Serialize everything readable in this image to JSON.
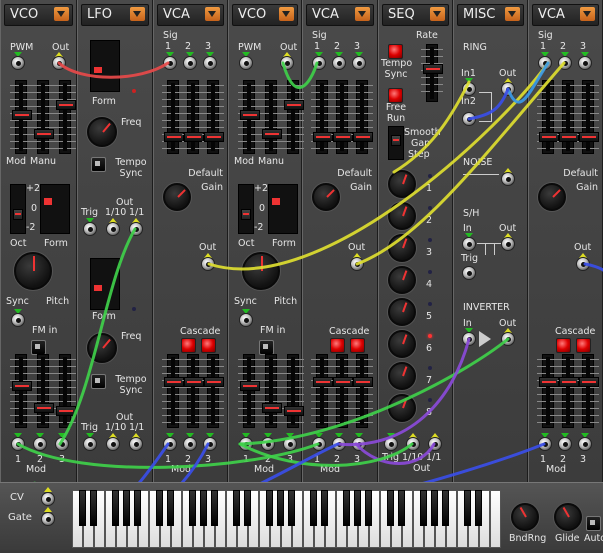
{
  "modules": [
    {
      "id": "vco1",
      "title": "VCO",
      "labels": {
        "pwm": "PWM",
        "out": "Out",
        "mod": "Mod",
        "manu": "Manu",
        "plus2": "+2",
        "zero": "0",
        "minus2": "-2",
        "oct": "Oct",
        "form": "Form",
        "sync": "Sync",
        "pitch": "Pitch",
        "fm_in": "FM in",
        "n1": "1",
        "n2": "2",
        "n3": "3",
        "mod_footer": "Mod"
      }
    },
    {
      "id": "lfo",
      "title": "LFO",
      "labels": {
        "form": "Form",
        "freq": "Freq",
        "tempo_sync": "Tempo Sync",
        "out": "Out",
        "trig": "Trig",
        "div10": "1/10",
        "div1": "1/1",
        "form2": "Form",
        "freq2": "Freq",
        "tempo_sync2": "Tempo Sync",
        "out2": "Out",
        "trig2": "Trig",
        "div10b": "1/10",
        "div1b": "1/1"
      }
    },
    {
      "id": "vca1",
      "title": "VCA",
      "labels": {
        "sig": "Sig",
        "n1": "1",
        "n2": "2",
        "n3": "3",
        "default_gain": "Default Gain",
        "out": "Out",
        "cascade": "Cascade",
        "mod_footer": "Mod"
      }
    },
    {
      "id": "vco2",
      "title": "VCO",
      "labels": {
        "pwm": "PWM",
        "out": "Out",
        "mod": "Mod",
        "manu": "Manu",
        "plus2": "+2",
        "zero": "0",
        "minus2": "-2",
        "oct": "Oct",
        "form": "Form",
        "sync": "Sync",
        "pitch": "Pitch",
        "fm_in": "FM in",
        "n1": "1",
        "n2": "2",
        "n3": "3",
        "mod_footer": "Mod"
      }
    },
    {
      "id": "vca2",
      "title": "VCA",
      "labels": {
        "sig": "Sig",
        "n1": "1",
        "n2": "2",
        "n3": "3",
        "default_gain": "Default Gain",
        "out": "Out",
        "cascade": "Cascade",
        "mod_footer": "Mod"
      }
    },
    {
      "id": "seq",
      "title": "SEQ",
      "labels": {
        "rate": "Rate",
        "tempo_sync": "Tempo Sync",
        "free_run": "Free Run",
        "smooth": "Smooth",
        "gap": "Gap",
        "step": "Step",
        "trig": "Trig",
        "div10": "1/10",
        "div1": "1/1",
        "out": "Out"
      },
      "steps": [
        "1",
        "2",
        "3",
        "4",
        "5",
        "6",
        "7",
        "8"
      ]
    },
    {
      "id": "misc",
      "title": "MISC",
      "labels": {
        "ring": "RING",
        "in1": "In1",
        "in2": "In2",
        "out": "Out",
        "noise": "NOISE",
        "sh": "S/H",
        "sh_in": "In",
        "sh_out": "Out",
        "trig": "Trig",
        "inverter": "INVERTER",
        "inv_in": "In",
        "inv_out": "Out"
      }
    },
    {
      "id": "vca3",
      "title": "VCA",
      "labels": {
        "sig": "Sig",
        "n1": "1",
        "n2": "2",
        "n3": "3",
        "default_gain": "Default Gain",
        "out": "Out",
        "cascade": "Cascade",
        "mod_footer": "Mod"
      }
    }
  ],
  "keyboard": {
    "cv": "CV",
    "gate": "Gate",
    "bend_range": "BndRng",
    "glide": "Glide",
    "auto": "Auto"
  },
  "colors": {
    "red_cable": "#e84a4a",
    "green_cable": "#3fd04a",
    "yellow_cable": "#dede30",
    "blue_cable": "#3a4ee8",
    "purple_cable": "#8a4ad8",
    "cyan_cable": "#3a9ae8",
    "accent": "#e8812a"
  }
}
